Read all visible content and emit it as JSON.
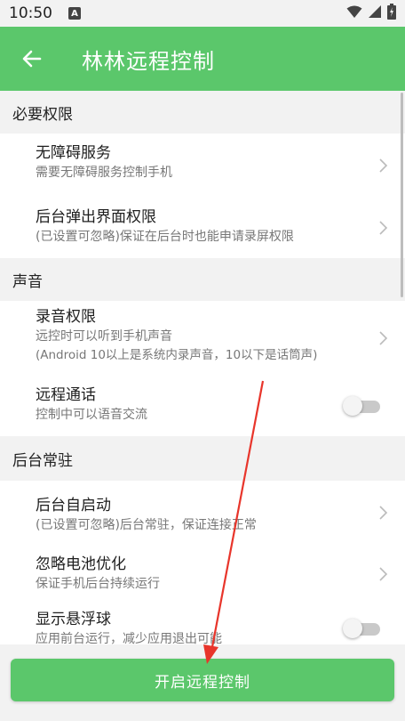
{
  "status": {
    "time": "10:50",
    "a_badge": "A"
  },
  "appbar": {
    "title": "林林远程控制"
  },
  "sections": [
    {
      "header": "必要权限",
      "items": [
        {
          "title": "无障碍服务",
          "sub": "需要无障碍服务控制手机",
          "control": "chevron"
        },
        {
          "title": "后台弹出界面权限",
          "sub": "(已设置可忽略)保证在后台时也能申请录屏权限",
          "control": "chevron"
        }
      ]
    },
    {
      "header": "声音",
      "items": [
        {
          "title": "录音权限",
          "sub": "远控时可以听到手机声音",
          "sub2": "(Android 10以上是系统内录声音，10以下是话筒声)",
          "control": "chevron"
        },
        {
          "title": "远程通话",
          "sub": "控制中可以语音交流",
          "control": "toggle",
          "toggle_on": false
        }
      ]
    },
    {
      "header": "后台常驻",
      "items": [
        {
          "title": "后台自启动",
          "sub": "(已设置可忽略)后台常驻，保证连接正常",
          "control": "chevron"
        },
        {
          "title": "忽略电池优化",
          "sub": "保证手机后台持续运行",
          "control": "chevron"
        },
        {
          "title": "显示悬浮球",
          "sub": "应用前台运行，减少应用退出可能",
          "control": "toggle",
          "toggle_on": false
        }
      ]
    }
  ],
  "bottom": {
    "start_label": "开启远程控制"
  },
  "colors": {
    "accent": "#5bc76b",
    "annotation": "#e8352b"
  }
}
